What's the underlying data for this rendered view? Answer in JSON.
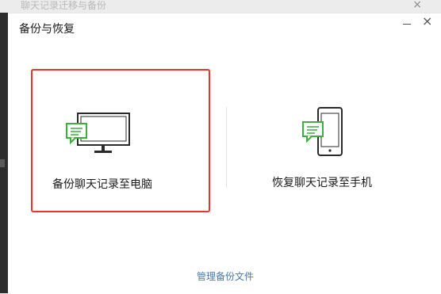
{
  "background_window": {
    "title": "聊天记录迁移与备份",
    "close_glyph": "×"
  },
  "dialog": {
    "title": "备份与恢复",
    "minimize_icon": "minimize-icon",
    "close_glyph": "×"
  },
  "options": [
    {
      "label": "备份聊天记录至电脑",
      "icon": "computer-chat-icon",
      "selected": true
    },
    {
      "label": "恢复聊天记录至手机",
      "icon": "phone-chat-icon",
      "selected": false
    }
  ],
  "manage_link": "管理备份文件",
  "colors": {
    "selection_border": "#e8352f",
    "icon_accent": "#3caf3c",
    "link": "#4a78a8"
  }
}
